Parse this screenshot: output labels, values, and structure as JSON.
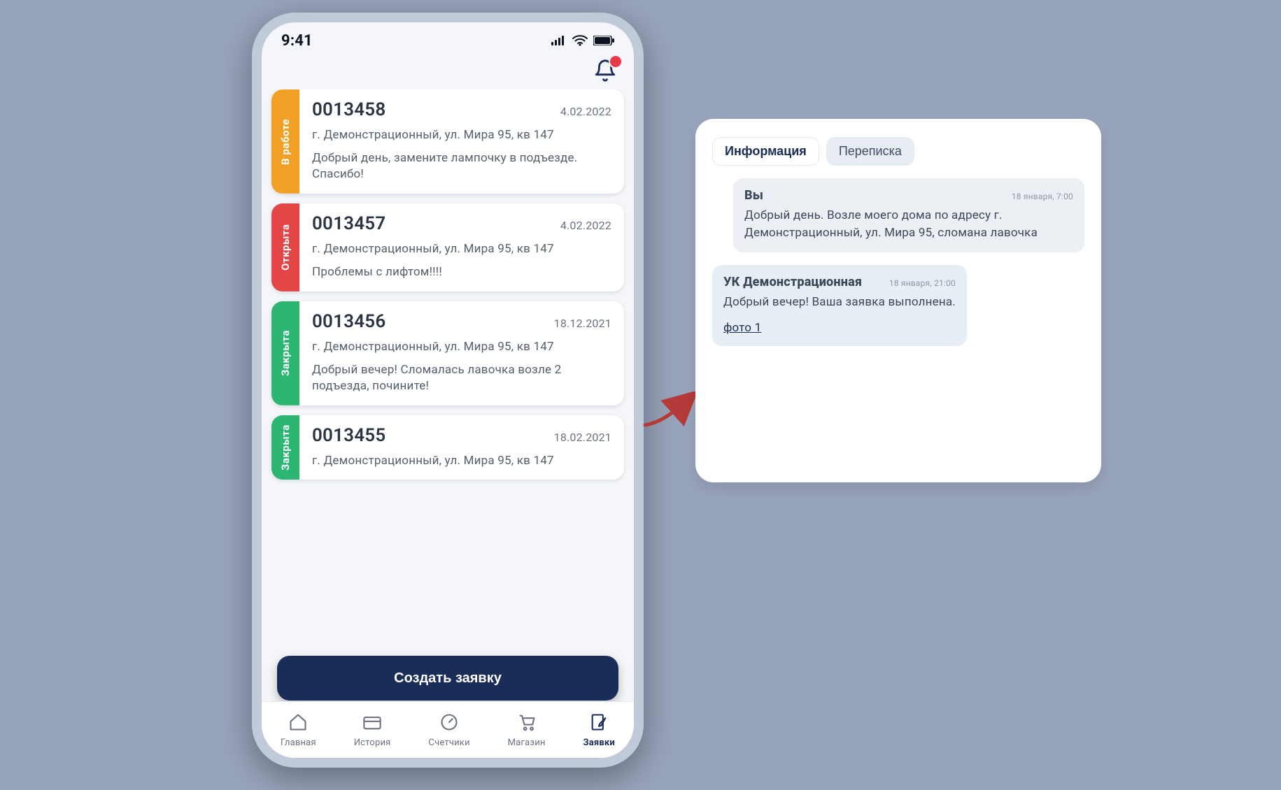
{
  "status_bar": {
    "time": "9:41"
  },
  "tickets": [
    {
      "status_label": "В работе",
      "status_color": "orange",
      "id": "0013458",
      "date": "4.02.2022",
      "address": "г. Демонстрационный, ул. Мира 95, кв 147",
      "message": "Добрый день, замените лампочку в подъезде. Спасибо!"
    },
    {
      "status_label": "Открыта",
      "status_color": "red",
      "id": "0013457",
      "date": "4.02.2022",
      "address": "г. Демонстрационный, ул. Мира 95, кв 147",
      "message": "Проблемы с лифтом!!!!"
    },
    {
      "status_label": "Закрыта",
      "status_color": "green",
      "id": "0013456",
      "date": "18.12.2021",
      "address": "г. Демонстрационный, ул. Мира 95, кв 147",
      "message": "Добрый вечер! Сломалась лавочка возле 2 подъезда, почините!"
    },
    {
      "status_label": "Закрыта",
      "status_color": "green",
      "id": "0013455",
      "date": "18.02.2021",
      "address": "г. Демонстрационный, ул. Мира 95, кв 147",
      "message": ""
    }
  ],
  "cta_label": "Создать заявку",
  "tabbar": {
    "items": [
      {
        "label": "Главная",
        "name": "home"
      },
      {
        "label": "История",
        "name": "history"
      },
      {
        "label": "Счетчики",
        "name": "meters"
      },
      {
        "label": "Магазин",
        "name": "shop"
      },
      {
        "label": "Заявки",
        "name": "tickets",
        "active": true
      }
    ]
  },
  "chat": {
    "tabs": {
      "info": "Информация",
      "thread": "Переписка",
      "active": "thread"
    },
    "messages": [
      {
        "side": "user",
        "author": "Вы",
        "time": "18 января, 7:00",
        "text": "Добрый день. Возле моего дома по адресу  г. Демонстрационный, ул. Мира 95, сломана лавочка"
      },
      {
        "side": "operator",
        "author": "УК Демонстрационная",
        "time": "18 января, 21:00",
        "text": "Добрый вечер! Ваша заявка выполнена.",
        "attachment": "фото 1"
      }
    ]
  }
}
